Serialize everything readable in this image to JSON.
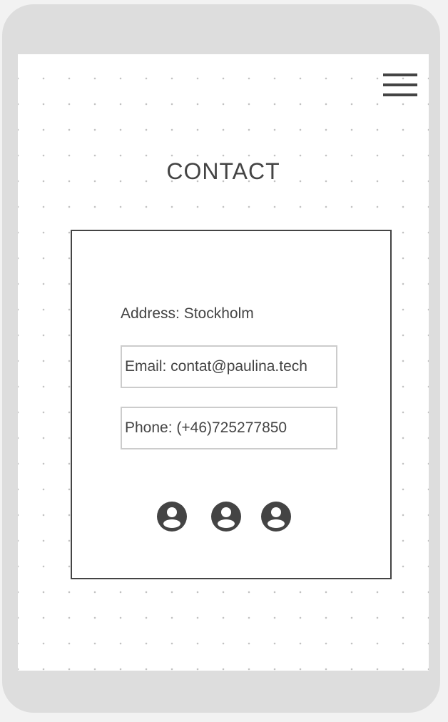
{
  "header": {
    "menu_icon": "hamburger-menu-icon"
  },
  "page": {
    "title": "CONTACT"
  },
  "contact": {
    "address": "Address: Stockholm",
    "email": "Email: contat@paulina.tech",
    "phone": "Phone: (+46)725277850"
  },
  "social": {
    "icons": [
      "account-circle-icon",
      "account-circle-icon",
      "account-circle-icon"
    ]
  },
  "colors": {
    "device_frame": "#dddddd",
    "screen": "#ffffff",
    "text": "#444444",
    "field_border": "#cccccc",
    "dot_grid": "#c2c2c2"
  }
}
